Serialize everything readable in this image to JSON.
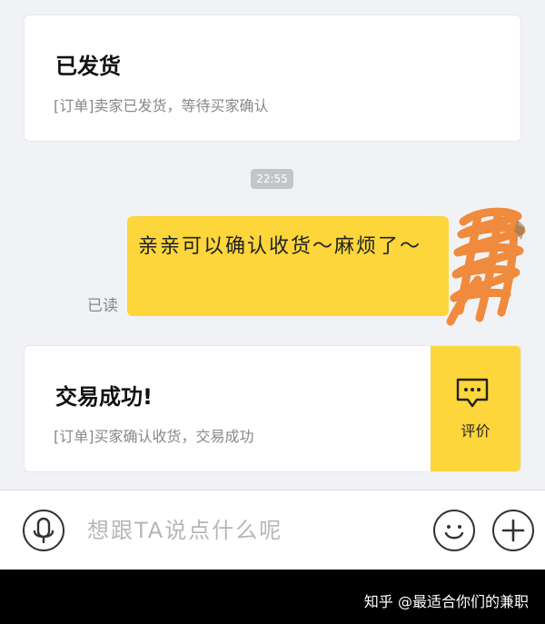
{
  "shipped_card": {
    "title": "已发货",
    "description": "[订单]卖家已发货，等待买家确认"
  },
  "timestamp": "22:55",
  "message": {
    "text": "亲亲可以确认收货～麻烦了～",
    "read_status": "已读"
  },
  "completed_card": {
    "title": "交易成功!",
    "description": "[订单]买家确认收货，交易成功",
    "review_label": "评价"
  },
  "input_bar": {
    "placeholder": "想跟TA说点什么呢"
  },
  "watermark": "知乎 @最适合你们的兼职",
  "colors": {
    "bubble": "#fcd63a",
    "review_button": "#fcd63a",
    "scribble": "#f08a3c",
    "background": "#f1f2f6"
  },
  "icons": [
    "microphone-icon",
    "smiley-icon",
    "plus-icon",
    "chat-bubble-icon"
  ]
}
